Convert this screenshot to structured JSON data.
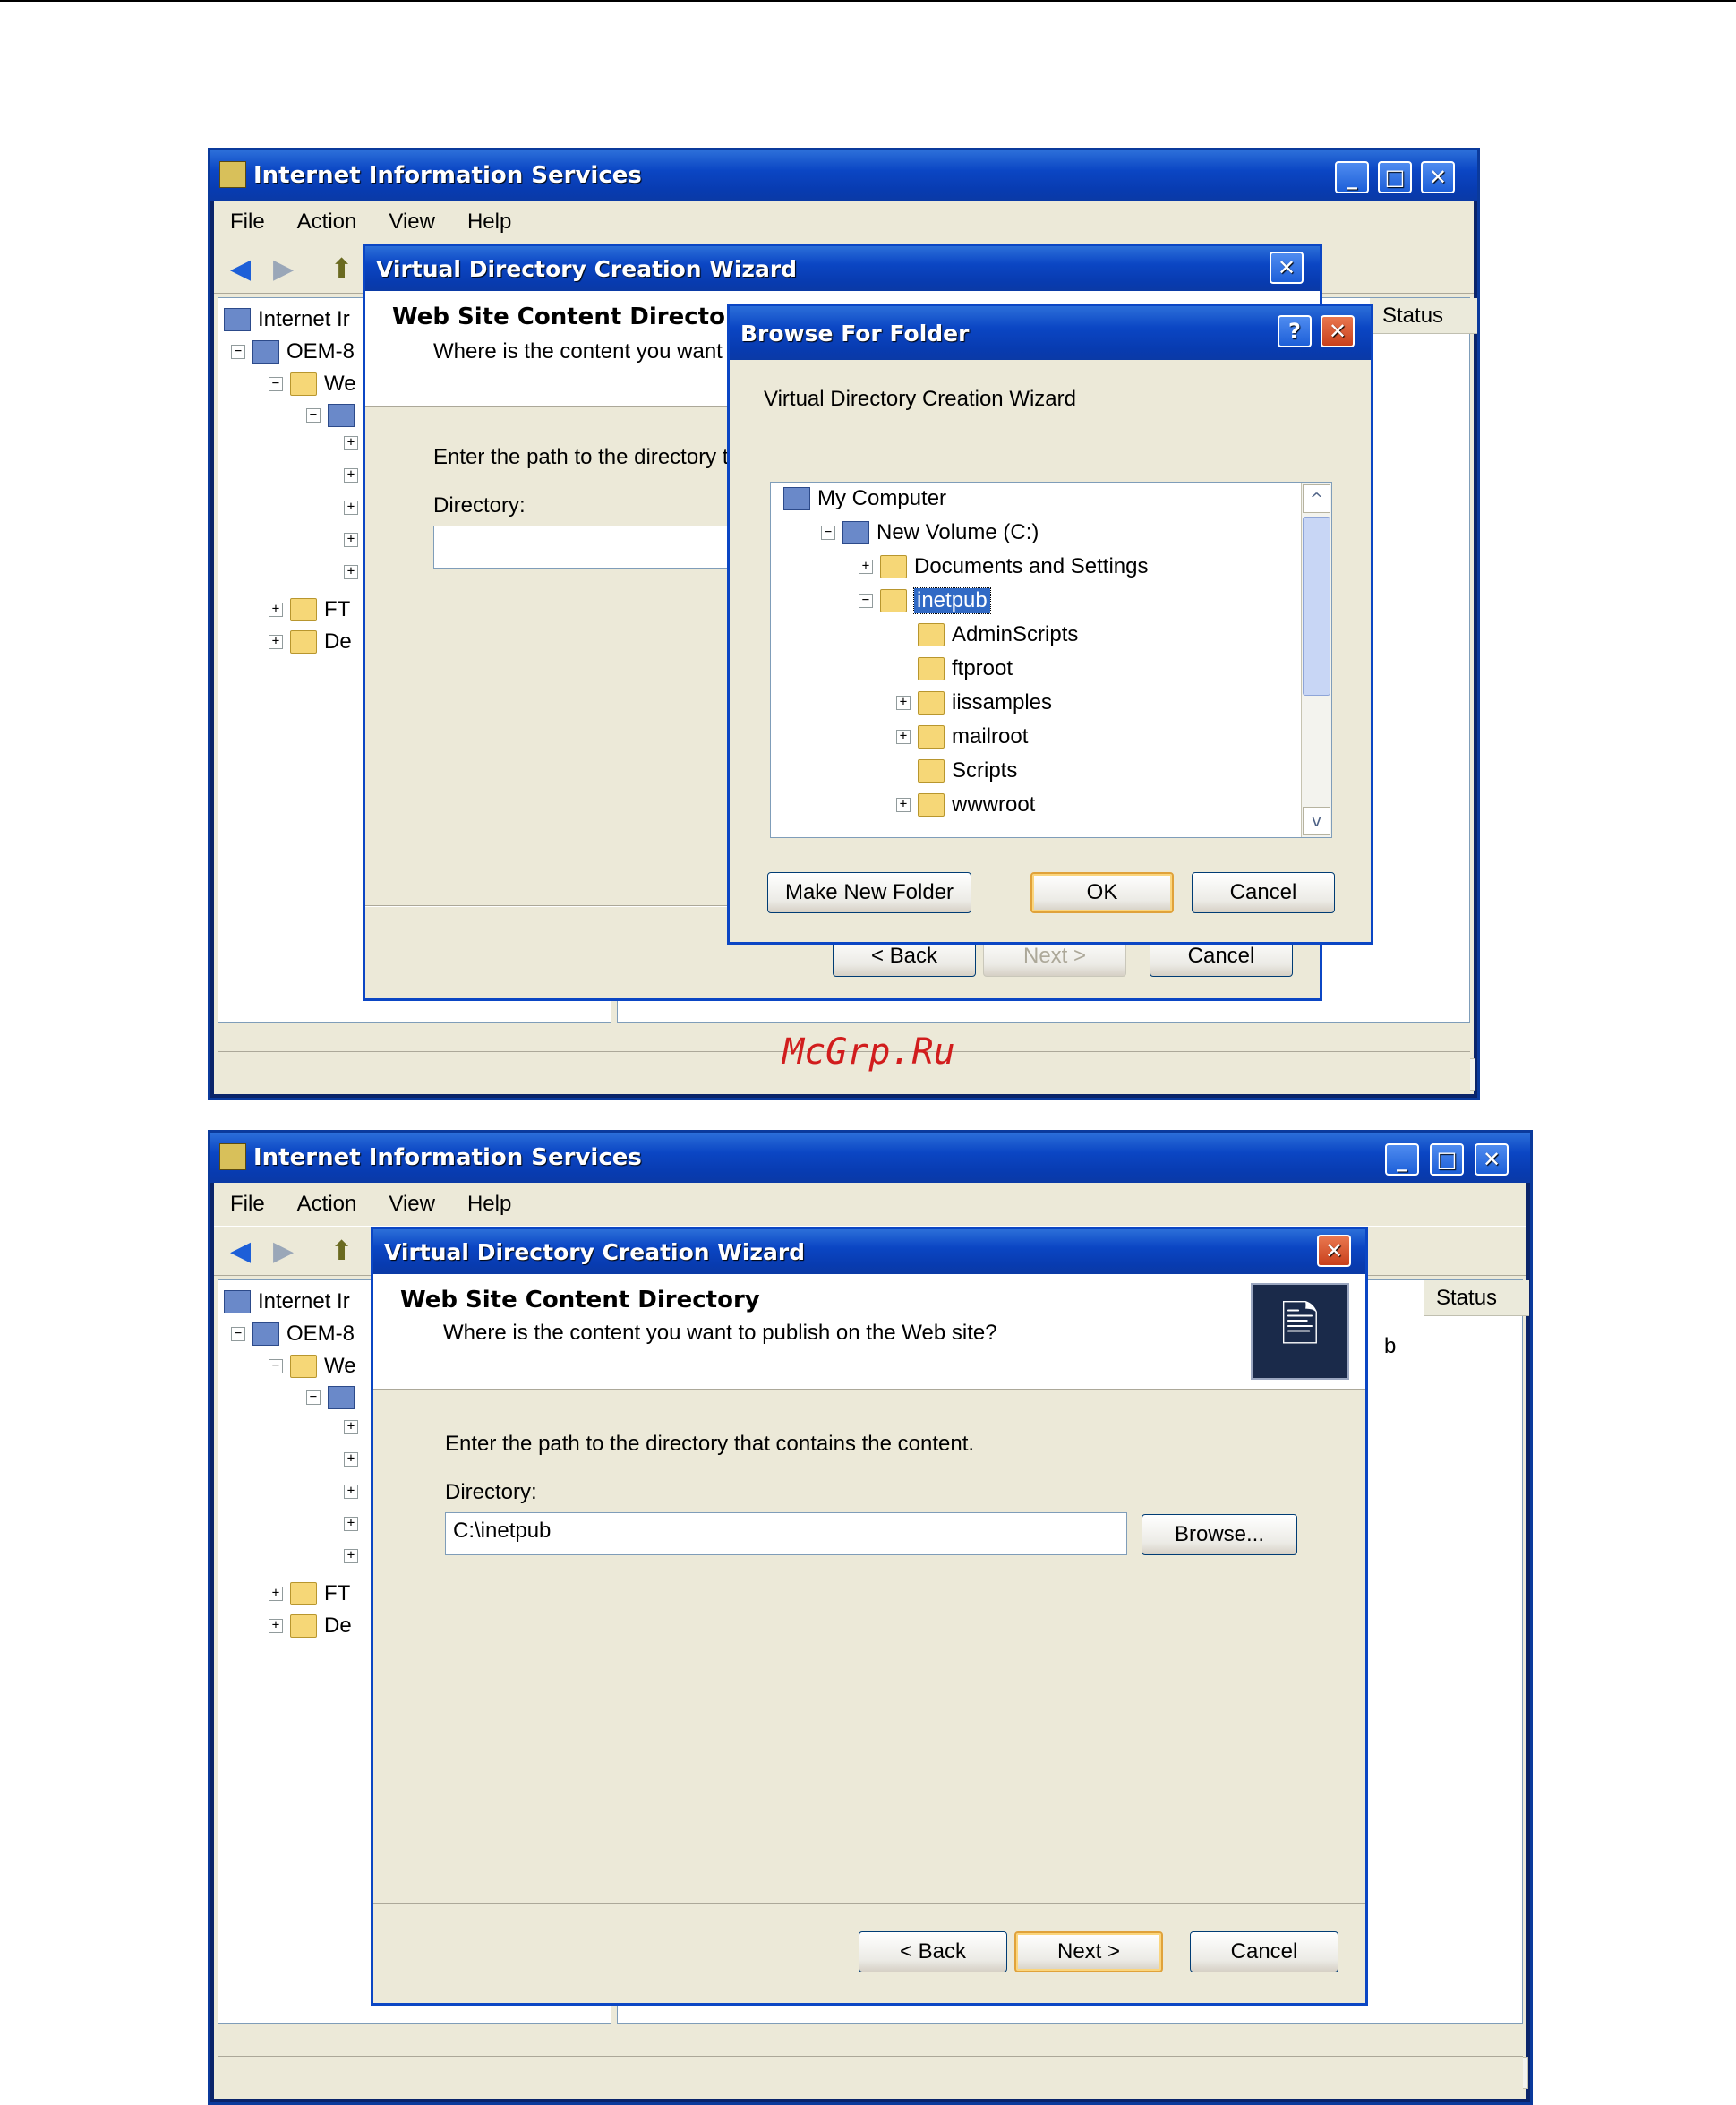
{
  "app": {
    "title": "Internet Information Services",
    "menu": [
      "File",
      "Action",
      "View",
      "Help"
    ],
    "tree_items": [
      "Internet Ir",
      "OEM-8",
      "We",
      "FT",
      "De"
    ],
    "tree_items_b": [
      "Internet Ir",
      "OEM-8",
      "We",
      "FT",
      "De"
    ],
    "status_column": "Status",
    "fragment_b": "b"
  },
  "wizard": {
    "title": "Virtual Directory Creation Wizard",
    "header_title": "Web Site Content Directory",
    "header_subtitle_partial": "Where is the content you want",
    "header_subtitle": "Where is the content you want to publish on the Web site?",
    "instruction_partial": "Enter the path to the directory tl",
    "instruction": "Enter the path to the directory that contains the content.",
    "directory_label": "Directory:",
    "directory_value": "C:\\inetpub",
    "browse_label": "Browse...",
    "back_label": "< Back",
    "next_label": "Next >",
    "cancel_label": "Cancel"
  },
  "browse": {
    "title": "Browse For Folder",
    "description": "Virtual Directory Creation Wizard",
    "tree": [
      {
        "label": "My Computer",
        "level": 0,
        "toggle": ""
      },
      {
        "label": "New Volume (C:)",
        "level": 1,
        "toggle": "−"
      },
      {
        "label": "Documents and Settings",
        "level": 2,
        "toggle": "+"
      },
      {
        "label": "inetpub",
        "level": 2,
        "toggle": "−",
        "selected": true
      },
      {
        "label": "AdminScripts",
        "level": 3,
        "toggle": ""
      },
      {
        "label": "ftproot",
        "level": 3,
        "toggle": ""
      },
      {
        "label": "iissamples",
        "level": 3,
        "toggle": "+"
      },
      {
        "label": "mailroot",
        "level": 3,
        "toggle": "+"
      },
      {
        "label": "Scripts",
        "level": 3,
        "toggle": ""
      },
      {
        "label": "wwwroot",
        "level": 3,
        "toggle": "+"
      }
    ],
    "make_new_folder_label": "Make New Folder",
    "ok_label": "OK",
    "cancel_label": "Cancel",
    "help_glyph": "?",
    "close_glyph": "✕"
  },
  "watermark": "McGrp.Ru",
  "icons": {
    "back": "◀",
    "forward": "▶",
    "up_folder": "⬆",
    "minimize": "_",
    "maximize": "□",
    "close": "✕",
    "scroll_left": "<",
    "scroll_right": ">",
    "scroll_up": "^",
    "scroll_down": "v",
    "wizard_icon": "🖹"
  }
}
